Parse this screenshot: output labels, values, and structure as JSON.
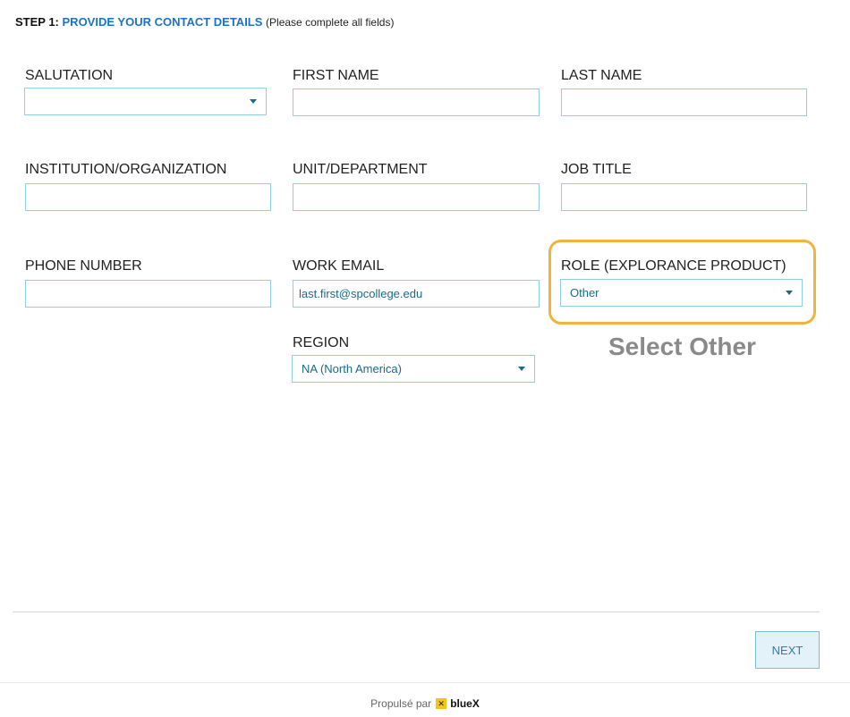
{
  "header": {
    "step_label": "STEP 1:",
    "step_title": "PROVIDE YOUR CONTACT DETAILS",
    "step_note": "(Please complete all fields)"
  },
  "fields": {
    "salutation": {
      "label": "SALUTATION",
      "value": ""
    },
    "first_name": {
      "label": "FIRST NAME",
      "value": ""
    },
    "last_name": {
      "label": "LAST NAME",
      "value": ""
    },
    "institution": {
      "label": "INSTITUTION/ORGANIZATION",
      "value": ""
    },
    "unit": {
      "label": "UNIT/DEPARTMENT",
      "value": ""
    },
    "job_title": {
      "label": "JOB TITLE",
      "value": ""
    },
    "phone": {
      "label": "PHONE NUMBER",
      "value": ""
    },
    "work_email": {
      "label": "WORK EMAIL",
      "value": "last.first@spcollege.edu"
    },
    "role": {
      "label": "ROLE (EXPLORANCE PRODUCT)",
      "value": "Other"
    },
    "region": {
      "label": "REGION",
      "value": "NA (North America)"
    }
  },
  "annotation": {
    "text": "Select Other",
    "color": "#f2b33d"
  },
  "actions": {
    "next_label": "NEXT"
  },
  "footer": {
    "powered_by": "Propulsé par",
    "brand_icon": "bluex-logo-icon",
    "brand_name": "blueX"
  }
}
